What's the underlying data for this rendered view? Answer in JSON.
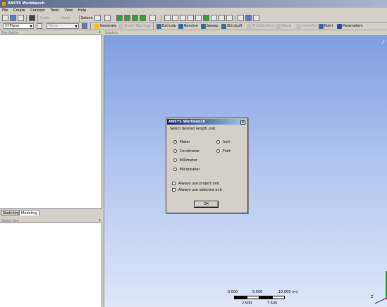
{
  "window": {
    "title": "ANSYS Workbench"
  },
  "menu": {
    "items": [
      "File",
      "Create",
      "Concept",
      "Tools",
      "View",
      "Help"
    ]
  },
  "toolbar1": {
    "undo_label": "Undo",
    "redo_label": "Redo",
    "select_label": "Select:"
  },
  "toolbar2": {
    "plane_value": "XYPlane",
    "sketch_value": "None",
    "generate_label": "Generate",
    "share_topology_label": "Share Topology",
    "extrude_label": "Extrude",
    "revolve_label": "Revolve",
    "sweep_label": "Sweep",
    "skin_loft_label": "Skin/Loft",
    "thin_surface_label": "Thin/Surface",
    "blend_label": "Blend",
    "chamfer_label": "Chamfer",
    "point_label": "Point",
    "parameters_label": "Parameters"
  },
  "tree_outline": {
    "title": "Tree Outline"
  },
  "tabs": {
    "sketching": "Sketching",
    "modeling": "Modeling"
  },
  "details_view": {
    "title": "Details View"
  },
  "graphics": {
    "title": "Graphics",
    "triad_z_label": "Z"
  },
  "scale": {
    "top_labels": [
      "0.000",
      "5.000",
      "10.000 (m)"
    ],
    "bottom_labels": [
      "2.500",
      "7.500"
    ]
  },
  "dialog": {
    "title": "ANSYS Workbench",
    "close_glyph": "x",
    "prompt": "Select desired length unit:",
    "units": [
      {
        "label": "Meter",
        "selected": true
      },
      {
        "label": "Centimeter",
        "selected": false
      },
      {
        "label": "Millimeter",
        "selected": false
      },
      {
        "label": "Micrometer",
        "selected": false
      },
      {
        "label": "Inch",
        "selected": false
      },
      {
        "label": "Foot",
        "selected": false
      }
    ],
    "always_project_label": "Always use project unit",
    "always_selected_label": "Always use selected unit",
    "ok_label": "OK"
  },
  "colors": {
    "graphics_top": "#7f9ee0",
    "graphics_bottom": "#dfe7f8",
    "dialog_title": "#0a246a"
  }
}
